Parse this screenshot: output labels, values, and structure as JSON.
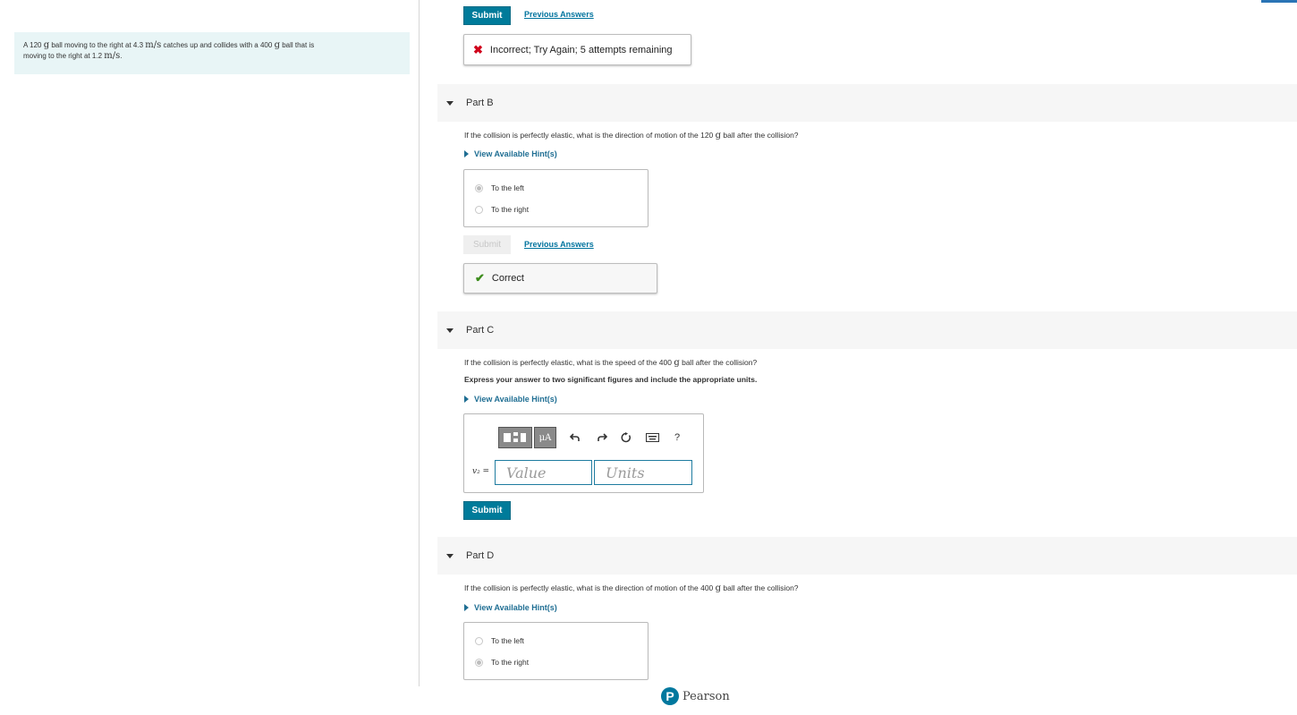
{
  "problem": {
    "text_parts": [
      "A 120 ",
      "g",
      " ball moving to the right at 4.3 ",
      "m/s",
      " catches up and collides with a 400 ",
      "g",
      " ball that is",
      "moving to the right at 1.2 ",
      "m/s",
      "."
    ]
  },
  "part_a": {
    "submit_label": "Submit",
    "previous_answers_label": "Previous Answers",
    "feedback_icon": "x-icon",
    "feedback_text": "Incorrect; Try Again; 5 attempts remaining"
  },
  "part_b": {
    "title": "Part B",
    "question_parts": [
      "If the collision is perfectly elastic, what is the direction of motion of the 120 ",
      "g",
      " ball after the collision?"
    ],
    "hint_label": "View Available Hint(s)",
    "choices": [
      "To the left",
      "To the right"
    ],
    "selected": "To the left",
    "submit_label": "Submit",
    "previous_answers_label": "Previous Answers",
    "feedback_icon": "check-icon",
    "feedback_text": "Correct"
  },
  "part_c": {
    "title": "Part C",
    "question_parts": [
      "If the collision is perfectly elastic, what is the speed of the 400 ",
      "g",
      " ball after the collision?"
    ],
    "instruction": "Express your answer to two significant figures and include the appropriate units.",
    "hint_label": "View Available Hint(s)",
    "toolbar": {
      "units_label": "μA",
      "help_label": "?",
      "icons": [
        "template-icon",
        "units-icon",
        "undo-icon",
        "redo-icon",
        "reset-icon",
        "keyboard-icon",
        "help-icon"
      ]
    },
    "variable_label": "v₂ =",
    "value_placeholder": "Value",
    "units_placeholder": "Units",
    "submit_label": "Submit"
  },
  "part_d": {
    "title": "Part D",
    "question_parts": [
      "If the collision is perfectly elastic, what is the direction of motion of the 400 ",
      "g",
      " ball after the collision?"
    ],
    "hint_label": "View Available Hint(s)",
    "choices": [
      "To the left",
      "To the right"
    ],
    "selected": "To the right"
  },
  "footer": {
    "brand": "Pearson",
    "logo_letter": "P"
  },
  "colors": {
    "accent": "#007b9a",
    "link": "#00739e",
    "incorrect": "#d0021b",
    "correct": "#3c8c1c",
    "panel_bg": "#e8f5f6"
  }
}
